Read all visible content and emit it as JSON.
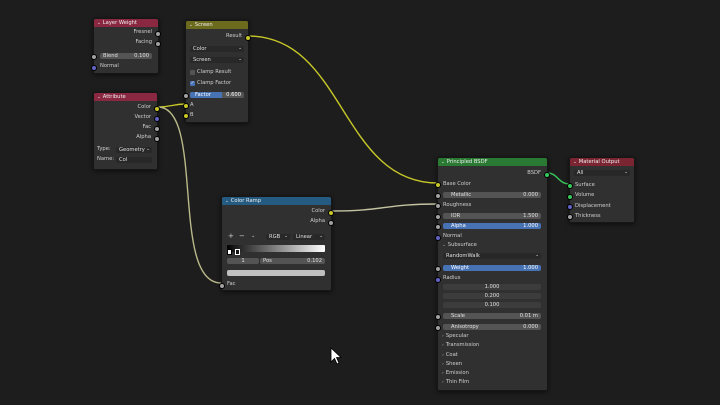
{
  "nodes": {
    "layer_weight": {
      "title": "Layer Weight",
      "outputs": [
        "Fresnel",
        "Facing"
      ],
      "blend": {
        "label": "Blend",
        "value": "0.100"
      },
      "inputs": [
        "Normal"
      ]
    },
    "screen": {
      "title": "Screen",
      "output": "Result",
      "dropdown1": "Color",
      "dropdown2": "Screen",
      "clamp_result": "Clamp Result",
      "clamp_factor": "Clamp Factor",
      "factor": {
        "label": "Factor",
        "value": "0.600"
      },
      "inputs": [
        "A",
        "B"
      ]
    },
    "attribute": {
      "title": "Attribute",
      "outputs": [
        "Color",
        "Vector",
        "Fac",
        "Alpha"
      ],
      "type_label": "Type:",
      "type_value": "Geometry",
      "name_label": "Name:",
      "name_value": "Col"
    },
    "color_ramp": {
      "title": "Color Ramp",
      "outputs": [
        "Color",
        "Alpha"
      ],
      "plus": "+",
      "minus": "−",
      "menu": "⌄",
      "mode": "RGB",
      "interp": "Linear",
      "stop_index": "1",
      "pos_label": "Pos",
      "pos_value": "0.102",
      "input": "Fac"
    },
    "principled": {
      "title": "Principled BSDF",
      "output": "BSDF",
      "base_color": "Base Color",
      "metallic": {
        "label": "Metallic",
        "value": "0.000"
      },
      "roughness": "Roughness",
      "ior": {
        "label": "IOR",
        "value": "1.500"
      },
      "alpha": {
        "label": "Alpha",
        "value": "1.000"
      },
      "normal": "Normal",
      "subsurface": "Subsurface",
      "sss_method": "RandomWalk",
      "weight": {
        "label": "Weight",
        "value": "1.000"
      },
      "radius": "Radius",
      "radius_values": [
        "1.000",
        "0.200",
        "0.100"
      ],
      "scale": {
        "label": "Scale",
        "value": "0.01 m"
      },
      "anisotropy": {
        "label": "Anisotropy",
        "value": "0.000"
      },
      "panels": [
        "Specular",
        "Transmission",
        "Coat",
        "Sheen",
        "Emission",
        "Thin Film"
      ]
    },
    "material_output": {
      "title": "Material Output",
      "target": "All",
      "inputs": [
        "Surface",
        "Volume",
        "Displacement",
        "Thickness"
      ]
    }
  },
  "colors": {
    "background": "#1d1d1d",
    "node_body": "#303030",
    "input_header": "#8a2842",
    "color_header": "#6c6b1d",
    "converter_header": "#255b81",
    "shader_header": "#2a7a34",
    "output_header": "#7b2533",
    "socket_color": "#c7c729",
    "socket_float": "#a1a1a1",
    "socket_vector": "#6363c7",
    "socket_shader": "#38c75a",
    "accent_field": "#4772b3"
  }
}
